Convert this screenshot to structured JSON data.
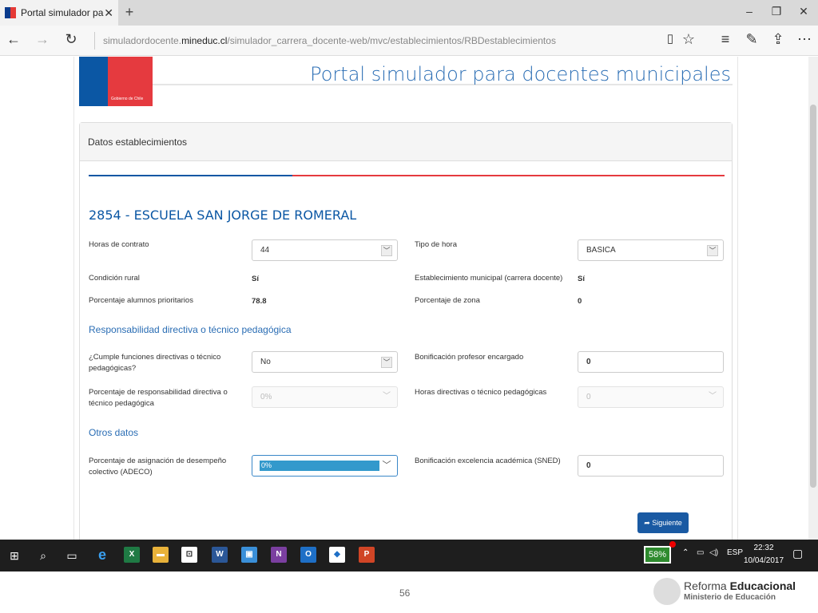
{
  "browser": {
    "tab_title": "Portal simulador para d",
    "url_prefix": "simuladordocente.",
    "url_domain": "mineduc.cl",
    "url_path": "/simulador_carrera_docente-web/mvc/establecimientos/RBDestablecimientos"
  },
  "header": {
    "logo_text": "Gobierno de Chile",
    "title": "Portal simulador para docentes municipales"
  },
  "panel": {
    "heading": "Datos establecimientos",
    "progress": 0.32,
    "school_name": "2854 - ESCUELA SAN JORGE DE ROMERAL"
  },
  "form": {
    "horas_contrato_label": "Horas de contrato",
    "horas_contrato_value": "44",
    "tipo_hora_label": "Tipo de hora",
    "tipo_hora_value": "BASICA",
    "condicion_rural_label": "Condición rural",
    "condicion_rural_value": "Sí",
    "estab_municipal_label": "Establecimiento municipal (carrera docente)",
    "estab_municipal_value": "Sí",
    "pct_prioritarios_label": "Porcentaje alumnos prioritarios",
    "pct_prioritarios_value": "78.8",
    "pct_zona_label": "Porcentaje de zona",
    "pct_zona_value": "0",
    "section_responsabilidad": "Responsabilidad directiva o técnico pedagógica",
    "cumple_label_1": "¿Cumple funciones directivas o técnico",
    "cumple_label_2": "pedagógicas?",
    "cumple_value": "No",
    "bonif_encargado_label": "Bonificación profesor encargado",
    "bonif_encargado_value": "0",
    "pct_resp_label_1": "Porcentaje de responsabilidad directiva o",
    "pct_resp_label_2": "técnico pedagógica",
    "pct_resp_value": "0%",
    "horas_directivas_label": "Horas directivas o técnico pedagógicas",
    "horas_directivas_value": "0",
    "section_otros": "Otros datos",
    "adeco_label_1": "Porcentaje de asignación de desempeño",
    "adeco_label_2": "colectivo (ADECO)",
    "adeco_value": "0%",
    "sned_label": "Bonificación excelencia académica (SNED)",
    "sned_value": "0",
    "next_button": "Siguiente"
  },
  "taskbar": {
    "battery": "58%",
    "lang": "ESP",
    "time": "22:32",
    "date": "10/04/2017"
  },
  "slide": {
    "page_number": "56",
    "reforma_1": "Reforma ",
    "reforma_2": "Educacional",
    "ministerio": "Ministerio de Educación"
  }
}
